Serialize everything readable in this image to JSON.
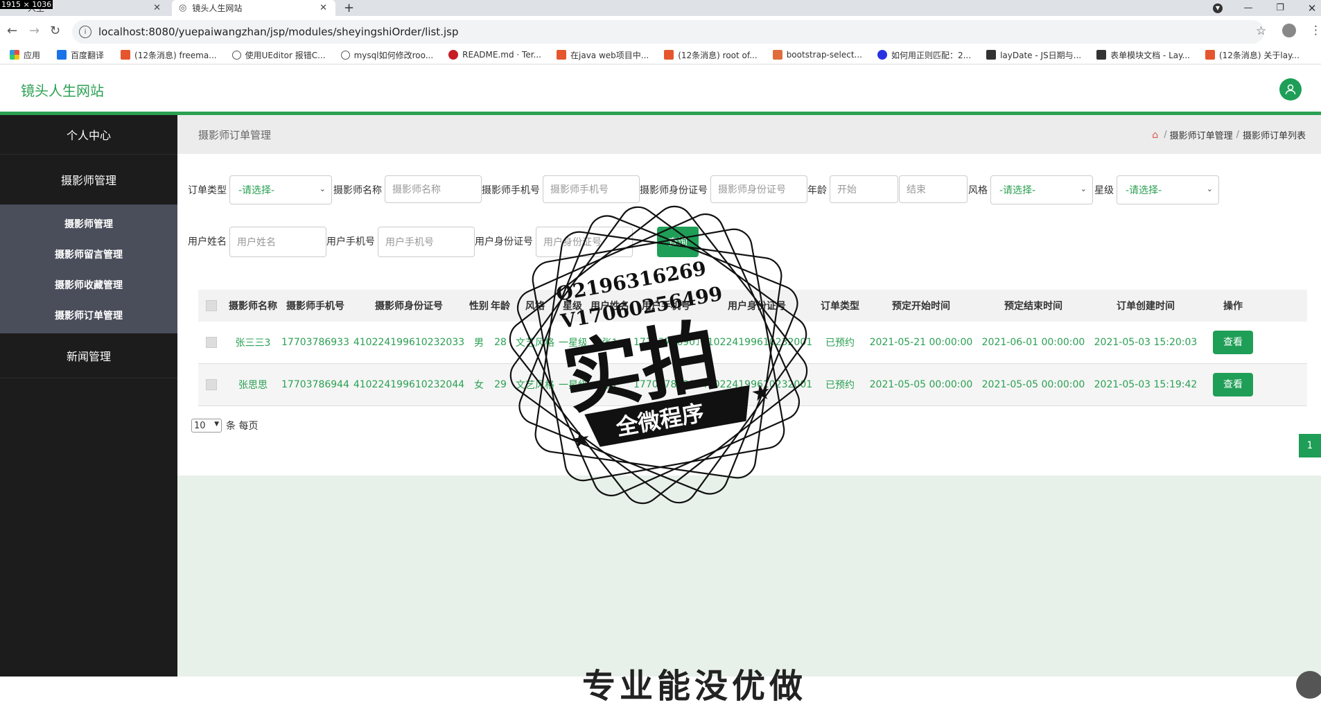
{
  "screen_dims": "1915 × 1036",
  "browser": {
    "tabs": [
      {
        "label": "人生"
      },
      {
        "label": "镜头人生网站"
      }
    ],
    "new_tab": "+",
    "url": "localhost:8080/yuepaiwangzhan/jsp/modules/sheyingshiOrder/list.jsp",
    "bookmarks": [
      {
        "label": "应用",
        "color": "#e74c3c"
      },
      {
        "label": "百度翻译",
        "color": "#1a73e8"
      },
      {
        "label": "(12条消息) freema...",
        "color": "#e5562e"
      },
      {
        "label": "使用UEditor 报错C...",
        "color": "#555555"
      },
      {
        "label": "mysql如何修改roo...",
        "color": "#555555"
      },
      {
        "label": "README.md · Ter...",
        "color": "#c71d23"
      },
      {
        "label": "在java web项目中...",
        "color": "#e5562e"
      },
      {
        "label": "(12条消息) root of...",
        "color": "#e5562e"
      },
      {
        "label": "bootstrap-select...",
        "color": "#e06c3c"
      },
      {
        "label": "如何用正则匹配：2...",
        "color": "#2932e1"
      },
      {
        "label": "layDate - JS日期与...",
        "color": "#333333"
      },
      {
        "label": "表单模块文档 - Lay...",
        "color": "#333333"
      },
      {
        "label": "(12条消息) 关于lay...",
        "color": "#e5562e"
      }
    ]
  },
  "header": {
    "brand": "镜头人生网站",
    "accent": "#2aa052"
  },
  "sidebar": {
    "top": "个人中心",
    "group": "摄影师管理",
    "sub_items": [
      "摄影师管理",
      "摄影师留言管理",
      "摄影师收藏管理",
      "摄影师订单管理"
    ],
    "news": "新闻管理"
  },
  "page": {
    "title": "摄影师订单管理",
    "breadcrumb": [
      "摄影师订单管理",
      "摄影师订单列表"
    ],
    "separator": "/"
  },
  "filters": {
    "order_type_label": "订单类型",
    "order_type_value": "-请选择-",
    "photographer_name_label": "摄影师名称",
    "photographer_name_placeholder": "摄影师名称",
    "photographer_phone_label": "摄影师手机号",
    "photographer_phone_placeholder": "摄影师手机号",
    "photographer_id_label": "摄影师身份证号",
    "photographer_id_placeholder": "摄影师身份证号",
    "age_label": "年龄",
    "age_start_placeholder": "开始",
    "age_end_placeholder": "结束",
    "style_label": "风格",
    "style_value": "-请选择-",
    "level_label": "星级",
    "level_value": "-请选择-",
    "user_name_label": "用户姓名",
    "user_name_placeholder": "用户姓名",
    "user_phone_label": "用户手机号",
    "user_phone_placeholder": "用户手机号",
    "user_id_label": "用户身份证号",
    "user_id_placeholder": "用户身份证号",
    "query_button": "查询"
  },
  "table": {
    "headers": [
      "摄影师名称",
      "摄影师手机号",
      "摄影师身份证号",
      "性别",
      "年龄",
      "风格",
      "星级",
      "用户姓名",
      "用户手机号",
      "用户身份证号",
      "订单类型",
      "预定开始时间",
      "预定结束时间",
      "订单创建时间",
      "操作"
    ],
    "rows": [
      [
        "张三三3",
        "17703786933",
        "410224199610232033",
        "男",
        "28",
        "文艺风格",
        "一星级",
        "张1",
        "17703786901",
        "410224199610232001",
        "已预约",
        "2021-05-21 00:00:00",
        "2021-06-01 00:00:00",
        "2021-05-03 15:20:03",
        "查看"
      ],
      [
        "张思思",
        "17703786944",
        "410224199610232044",
        "女",
        "29",
        "文艺风格",
        "一星级",
        "张1",
        "17703786901",
        "410224199610232001",
        "已预约",
        "2021-05-05 00:00:00",
        "2021-05-05 00:00:00",
        "2021-05-03 15:19:42",
        "查看"
      ]
    ]
  },
  "pagination": {
    "page_size": "10",
    "per_page_label": "条 每页",
    "current_page": "1"
  },
  "footer_teaser": "专业能没优做",
  "watermark": {
    "line1": "Q2196316269",
    "line2": "V17060256499",
    "main": "实拍",
    "banner": "全微程序"
  }
}
